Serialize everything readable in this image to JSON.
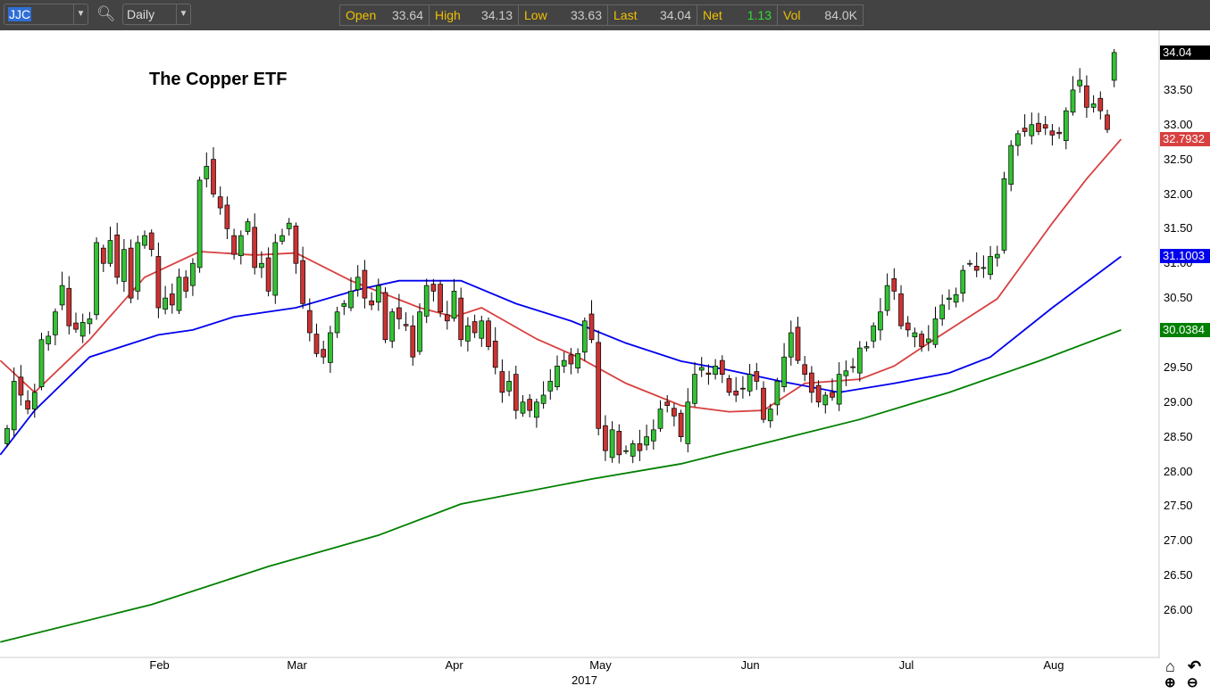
{
  "toolbar": {
    "symbol": "JJC",
    "interval": "Daily"
  },
  "quote": [
    {
      "label": "Open",
      "value": "33.64"
    },
    {
      "label": "High",
      "value": "34.13"
    },
    {
      "label": "Low",
      "value": "33.63"
    },
    {
      "label": "Last",
      "value": "34.04"
    },
    {
      "label": "Net",
      "value": "1.13"
    },
    {
      "label": "Vol",
      "value": "84.0K"
    }
  ],
  "title": "The Copper ETF",
  "badges": {
    "last": "34.04",
    "ma_red": "32.7932",
    "ma_blue": "31.1003",
    "ma_green": "30.0384"
  },
  "colors": {
    "up": "#33c233",
    "down": "#cc3333",
    "red": "#d84040",
    "blue": "#0000ee",
    "green": "#008000",
    "net": "#33dd33"
  },
  "price_axis": [
    "33.50",
    "33.00",
    "32.50",
    "32.00",
    "31.50",
    "31.00",
    "30.50",
    "29.50",
    "29.00",
    "28.50",
    "28.00",
    "27.50",
    "27.00",
    "26.50",
    "26.00"
  ],
  "date_axis": [
    {
      "label": "Feb",
      "i": 22
    },
    {
      "label": "Mar",
      "i": 42
    },
    {
      "label": "Apr",
      "i": 65
    },
    {
      "label": "May",
      "i": 86
    },
    {
      "label": "Jun",
      "i": 108
    },
    {
      "label": "Jul",
      "i": 131
    },
    {
      "label": "Aug",
      "i": 152
    }
  ],
  "year": "2017",
  "chart_data": {
    "type": "candlestick",
    "ylim": [
      25.35,
      34.35
    ],
    "closes": [
      28.62,
      29.3,
      29.1,
      28.9,
      29.14,
      29.9,
      29.95,
      30.3,
      30.68,
      30.1,
      30.05,
      30.15,
      30.2,
      31.3,
      31.0,
      31.33,
      30.8,
      31.2,
      30.5,
      31.3,
      31.4,
      31.2,
      30.36,
      30.5,
      30.4,
      30.8,
      30.6,
      31.0,
      32.2,
      32.4,
      32.0,
      31.8,
      31.5,
      31.13,
      31.4,
      31.6,
      30.94,
      31.0,
      30.6,
      31.3,
      31.4,
      31.58,
      31.0,
      30.42,
      30.0,
      29.7,
      29.65,
      30.0,
      30.3,
      30.42,
      30.6,
      30.8,
      30.5,
      30.4,
      30.68,
      29.9,
      30.3,
      30.2,
      30.1,
      29.65,
      30.3,
      30.68,
      30.6,
      30.3,
      30.17,
      30.6,
      29.9,
      30.1,
      30.0,
      30.17,
      29.8,
      29.5,
      29.14,
      29.3,
      28.88,
      29.0,
      28.88,
      29.0,
      29.1,
      29.3,
      29.52,
      29.6,
      29.55,
      29.7,
      30.17,
      29.9,
      28.62,
      28.3,
      28.6,
      28.24,
      28.3,
      28.4,
      28.3,
      28.5,
      28.6,
      28.9,
      28.95,
      28.8,
      28.5,
      29.0,
      29.4,
      29.5,
      29.4,
      29.52,
      29.4,
      29.14,
      29.1,
      29.2,
      29.4,
      29.3,
      28.75,
      28.9,
      29.3,
      29.65,
      30.0,
      29.6,
      29.4,
      29.14,
      29.0,
      29.1,
      29.07,
      29.4,
      29.45,
      29.5,
      29.78,
      29.8,
      30.1,
      30.3,
      30.68,
      30.6,
      30.1,
      30.04,
      30.0,
      29.8,
      29.91,
      30.2,
      30.4,
      30.5,
      30.55,
      30.9,
      31.0,
      30.9,
      30.94,
      31.1,
      31.13,
      32.22,
      32.7,
      32.87,
      32.9,
      33.0,
      32.9,
      32.95,
      32.85,
      32.87,
      33.2,
      33.5,
      33.64,
      33.25,
      33.3,
      33.2,
      32.93,
      34.04
    ],
    "ma_red": [
      [
        -1,
        29.6
      ],
      [
        4,
        29.14
      ],
      [
        12,
        29.9
      ],
      [
        20,
        30.8
      ],
      [
        28,
        31.17
      ],
      [
        36,
        31.12
      ],
      [
        42,
        31.15
      ],
      [
        50,
        30.75
      ],
      [
        60,
        30.36
      ],
      [
        65,
        30.23
      ],
      [
        69,
        30.36
      ],
      [
        77,
        29.91
      ],
      [
        83,
        29.65
      ],
      [
        90,
        29.27
      ],
      [
        98,
        28.95
      ],
      [
        105,
        28.86
      ],
      [
        110,
        28.88
      ],
      [
        116,
        29.27
      ],
      [
        124,
        29.33
      ],
      [
        129,
        29.52
      ],
      [
        134,
        29.85
      ],
      [
        139,
        30.17
      ],
      [
        144,
        30.49
      ],
      [
        152,
        31.58
      ],
      [
        157,
        32.22
      ],
      [
        162,
        32.79
      ]
    ],
    "ma_blue": [
      [
        -1,
        28.24
      ],
      [
        4,
        28.88
      ],
      [
        12,
        29.65
      ],
      [
        22,
        29.97
      ],
      [
        27,
        30.04
      ],
      [
        33,
        30.23
      ],
      [
        42,
        30.36
      ],
      [
        51,
        30.62
      ],
      [
        57,
        30.75
      ],
      [
        66,
        30.75
      ],
      [
        74,
        30.42
      ],
      [
        82,
        30.17
      ],
      [
        90,
        29.85
      ],
      [
        98,
        29.59
      ],
      [
        105,
        29.46
      ],
      [
        113,
        29.29
      ],
      [
        121,
        29.14
      ],
      [
        129,
        29.27
      ],
      [
        137,
        29.42
      ],
      [
        143,
        29.65
      ],
      [
        152,
        30.36
      ],
      [
        162,
        31.1
      ]
    ],
    "ma_green": [
      [
        -1,
        25.54
      ],
      [
        21,
        26.08
      ],
      [
        38,
        26.63
      ],
      [
        54,
        27.08
      ],
      [
        66,
        27.53
      ],
      [
        85,
        27.89
      ],
      [
        98,
        28.11
      ],
      [
        111,
        28.43
      ],
      [
        124,
        28.75
      ],
      [
        137,
        29.14
      ],
      [
        150,
        29.59
      ],
      [
        162,
        30.04
      ]
    ]
  }
}
